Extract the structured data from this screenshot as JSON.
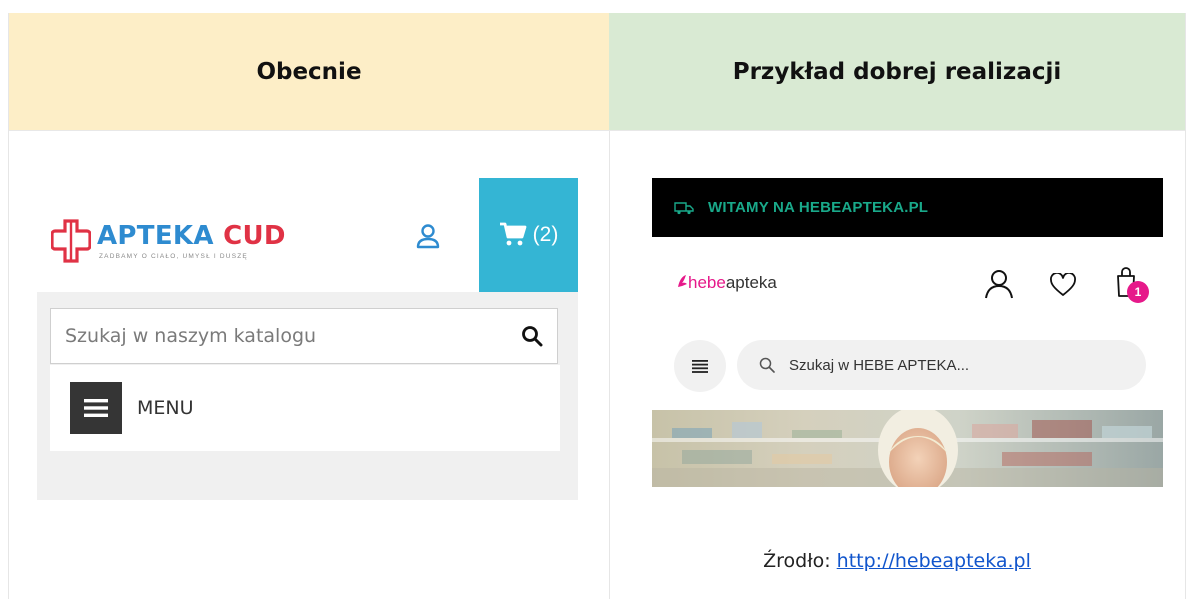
{
  "headers": {
    "left": "Obecnie",
    "right": "Przykład dobrej realizacji"
  },
  "current": {
    "brand_part1": "APTEKA",
    "brand_part2": "CUD",
    "tagline": "ZADBAMY O CIAŁO, UMYSŁ I DUSZĘ",
    "cart_count": "(2)",
    "search_placeholder": "Szukaj w naszym katalogu",
    "menu_label": "MENU",
    "colors": {
      "brand_blue": "#2e8bd0",
      "brand_red": "#e03245",
      "cart_bg": "#34b5d4"
    }
  },
  "example": {
    "welcome_bar": "WITAMY NA HEBEAPTEKA.PL",
    "logo_part1": "hebe",
    "logo_part2": "apteka",
    "cart_badge": "1",
    "search_placeholder": "Szukaj w HEBE APTEKA...",
    "colors": {
      "accent": "#e6198a",
      "bar_text": "#19a98a"
    }
  },
  "source": {
    "label": "Źrodło:",
    "link": "http://hebeapteka.pl"
  }
}
